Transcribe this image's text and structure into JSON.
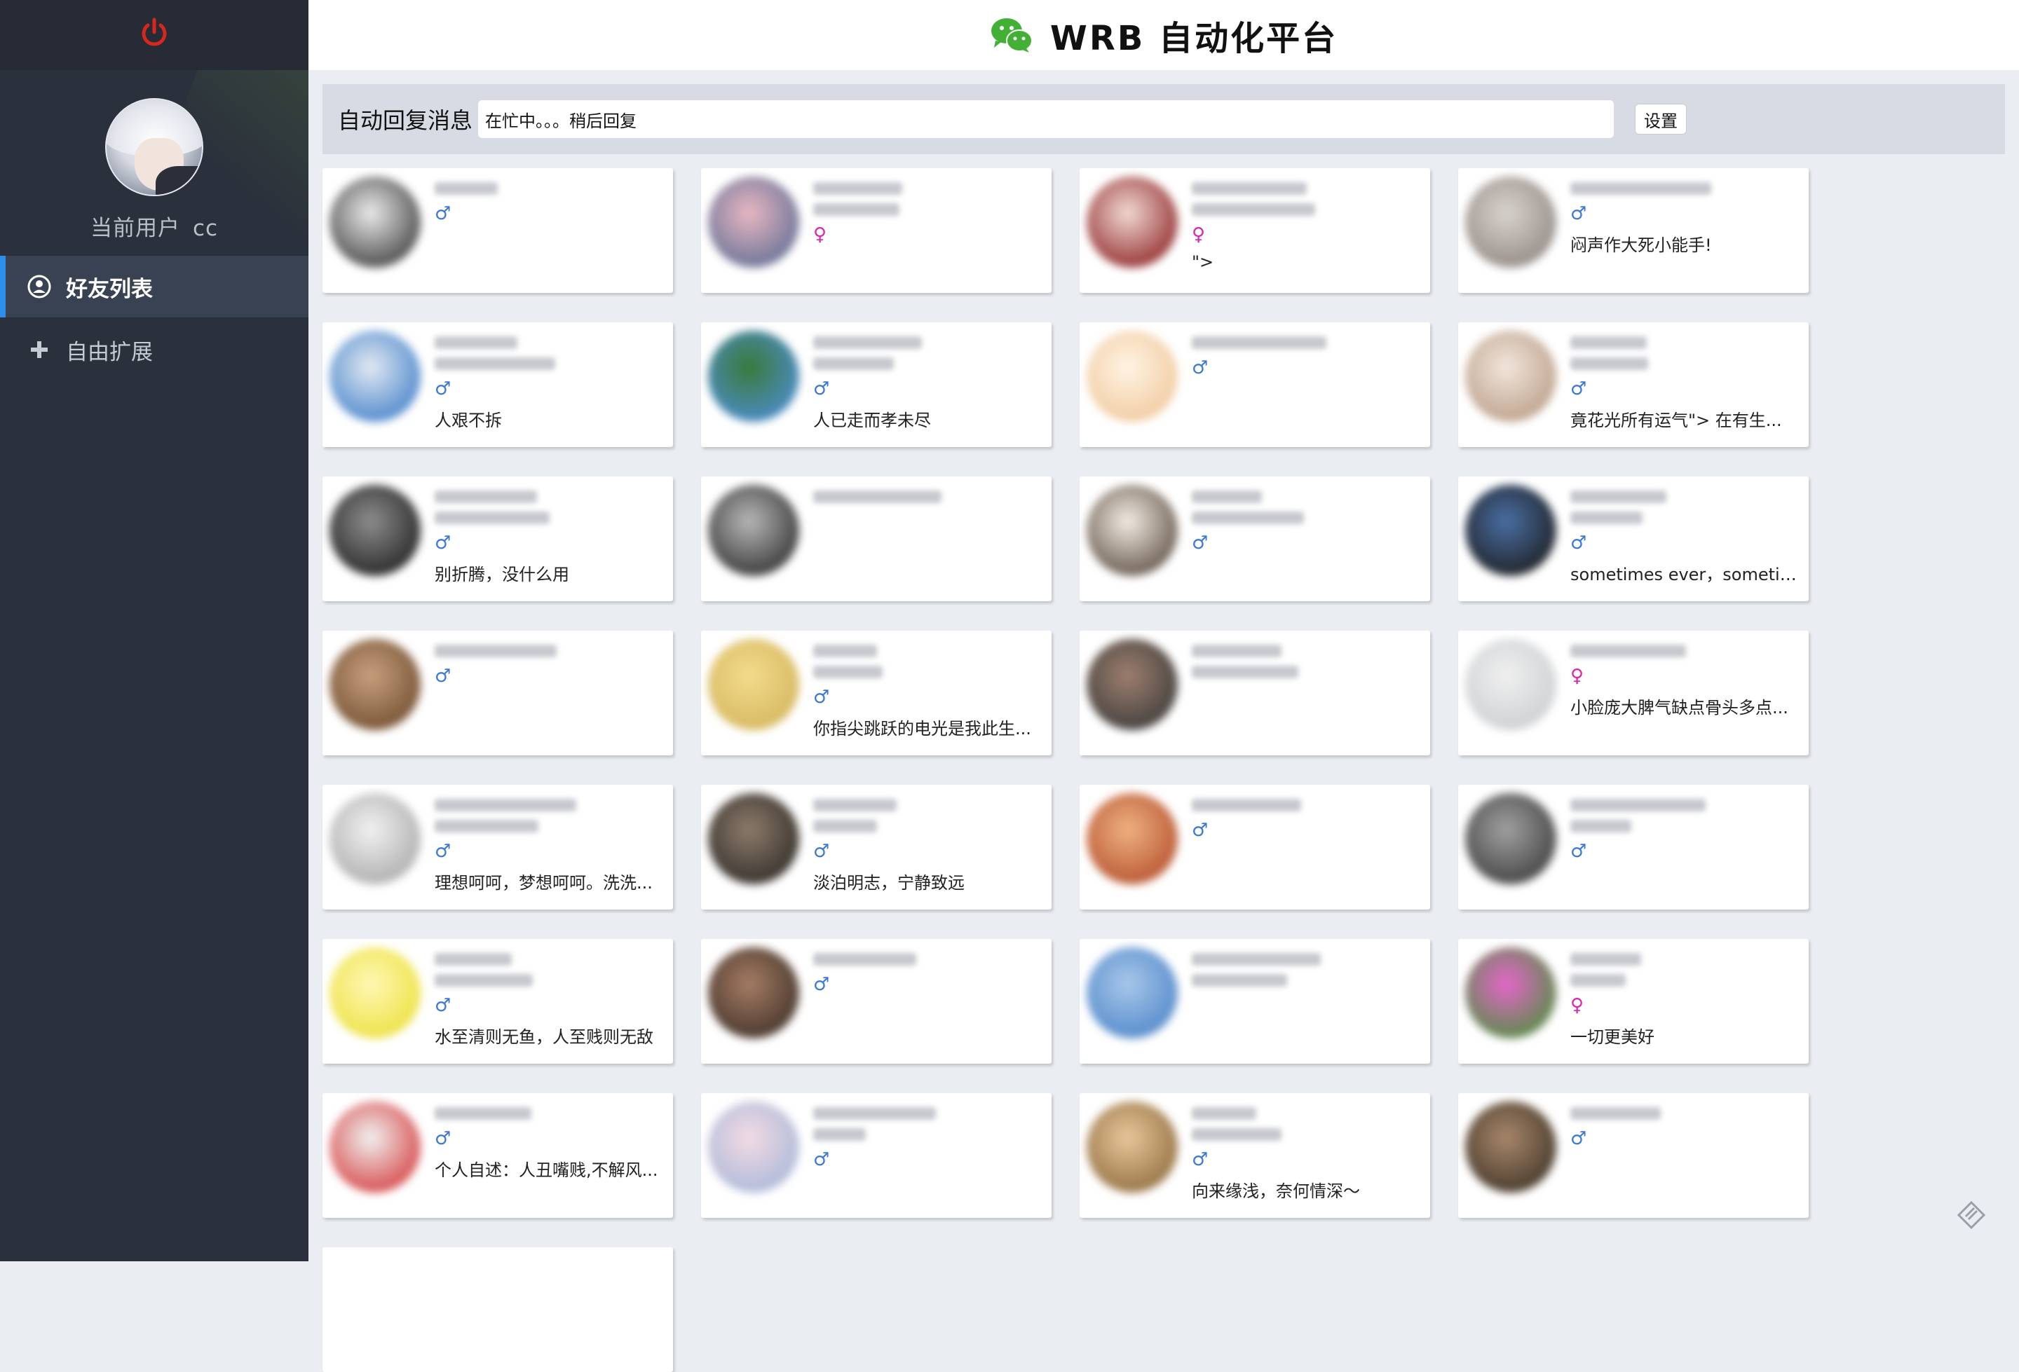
{
  "app": {
    "title": "WRB 自动化平台",
    "brand_color": "#41b035",
    "accent_color": "#2c8ff0"
  },
  "sidebar": {
    "power_icon": "power-icon",
    "current_user_label": "当前用户",
    "current_user_name": "cc",
    "items": [
      {
        "label": "好友列表",
        "icon": "user-circle-icon",
        "active": true
      },
      {
        "label": "自由扩展",
        "icon": "plus-icon",
        "active": false
      }
    ]
  },
  "auto_reply": {
    "label": "自动回复消息",
    "value": "在忙中。。。稍后回复",
    "button": "设置"
  },
  "friends": [
    {
      "sex": "♂",
      "gender": "male",
      "signature": "",
      "color1": "#eaeaea",
      "color2": "#3b3b3b"
    },
    {
      "sex": "♀",
      "gender": "female",
      "signature": "",
      "color1": "#e9b7c2",
      "color2": "#5d6d93"
    },
    {
      "sex": "♀",
      "gender": "female",
      "signature": "\">",
      "color1": "#f1d9d4",
      "color2": "#8c2222"
    },
    {
      "sex": "♂",
      "gender": "male",
      "signature": "闷声作大死小能手!",
      "color1": "#d9d3cf",
      "color2": "#8e8680"
    },
    {
      "sex": "♂",
      "gender": "male",
      "signature": "人艰不拆",
      "color1": "#e3e9f2",
      "color2": "#3f7fc9"
    },
    {
      "sex": "♂",
      "gender": "male",
      "signature": "人已走而孝未尽",
      "color1": "#3a7a3a",
      "color2": "#4d8ed6"
    },
    {
      "sex": "♂",
      "gender": "male",
      "signature": "",
      "color1": "#fff4e4",
      "color2": "#efc79a"
    },
    {
      "sex": "♂",
      "gender": "male",
      "signature": "竟花光所有运气\"> 在有生...",
      "color1": "#f2e6dc",
      "color2": "#b89b84"
    },
    {
      "sex": "♂",
      "gender": "male",
      "signature": "别折腾，没什么用",
      "color1": "#8d8d8d",
      "color2": "#1f1f1f"
    },
    {
      "sex": "",
      "gender": "none",
      "signature": "",
      "color1": "#b7b7b7",
      "color2": "#2d2d2d"
    },
    {
      "sex": "♂",
      "gender": "male",
      "signature": "",
      "color1": "#f3ece3",
      "color2": "#5b4c40"
    },
    {
      "sex": "♂",
      "gender": "male",
      "signature": "sometimes ever，sometim...",
      "color1": "#4a6ea3",
      "color2": "#1b1b1b"
    },
    {
      "sex": "♂",
      "gender": "male",
      "signature": "",
      "color1": "#c7a07e",
      "color2": "#6f4b2d"
    },
    {
      "sex": "♂",
      "gender": "male",
      "signature": "你指尖跳跃的电光是我此生...",
      "color1": "#f3dc8e",
      "color2": "#d3b45b"
    },
    {
      "sex": "",
      "gender": "none",
      "signature": "",
      "color1": "#9e7f6e",
      "color2": "#3a3a3a"
    },
    {
      "sex": "♀",
      "gender": "female",
      "signature": "小脸庞大脾气缺点骨头多点...",
      "color1": "#f0f0f0",
      "color2": "#c9cccf"
    },
    {
      "sex": "♂",
      "gender": "male",
      "signature": "理想呵呵，梦想呵呵。洗洗...",
      "color1": "#f1f1f1",
      "color2": "#a8a8a8"
    },
    {
      "sex": "♂",
      "gender": "male",
      "signature": "淡泊明志，宁静致远",
      "color1": "#8d7b6b",
      "color2": "#2e2a27"
    },
    {
      "sex": "♂",
      "gender": "male",
      "signature": "",
      "color1": "#efb181",
      "color2": "#b34e2b"
    },
    {
      "sex": "♂",
      "gender": "male",
      "signature": "",
      "color1": "#a0a0a0",
      "color2": "#3c3c3c"
    },
    {
      "sex": "♂",
      "gender": "male",
      "signature": "水至清则无鱼，人至贱则无敌",
      "color1": "#fff7b6",
      "color2": "#ebe039"
    },
    {
      "sex": "♂",
      "gender": "male",
      "signature": "",
      "color1": "#a57c63",
      "color2": "#3e3028"
    },
    {
      "sex": "",
      "gender": "none",
      "signature": "",
      "color1": "#a8c7ea",
      "color2": "#4d85c8"
    },
    {
      "sex": "♀",
      "gender": "female",
      "signature": "一切更美好",
      "color1": "#e466c9",
      "color2": "#4c8f3c"
    },
    {
      "sex": "♂",
      "gender": "male",
      "signature": "个人自述：人丑嘴贱,不解风...",
      "color1": "#f1f1f1",
      "color2": "#d43b3b"
    },
    {
      "sex": "♂",
      "gender": "male",
      "signature": "",
      "color1": "#f2dbe4",
      "color2": "#a7b6d8"
    },
    {
      "sex": "♂",
      "gender": "male",
      "signature": "向来缘浅，奈何情深～",
      "color1": "#e9c79a",
      "color2": "#8c6a3c"
    },
    {
      "sex": "♂",
      "gender": "male",
      "signature": "",
      "color1": "#a8876b",
      "color2": "#3e3326"
    }
  ]
}
